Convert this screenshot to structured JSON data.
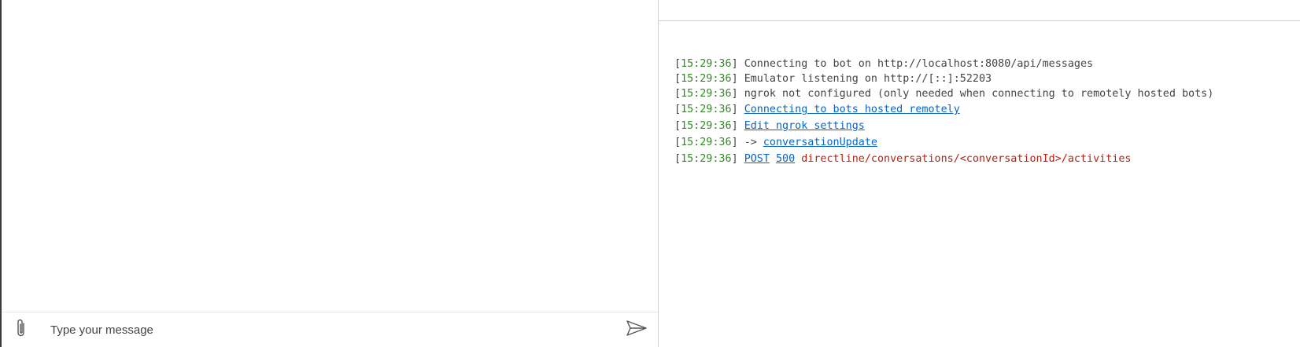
{
  "chat": {
    "input_placeholder": "Type your message",
    "input_value": ""
  },
  "icons": {
    "attach": "paperclip-icon",
    "send": "send-icon"
  },
  "colors": {
    "timestamp": "#2e8b20",
    "link": "#0a64c8",
    "error": "#b22312",
    "text": "#444444"
  },
  "log": {
    "entries": [
      {
        "timestamp": "15:29:36",
        "text": "Connecting to bot on http://localhost:8080/api/messages"
      },
      {
        "timestamp": "15:29:36",
        "text": "Emulator listening on http://[::]:52203"
      },
      {
        "timestamp": "15:29:36",
        "text": "ngrok not configured (only needed when connecting to remotely hosted bots)"
      },
      {
        "timestamp": "15:29:36",
        "link": "Connecting to bots hosted remotely"
      },
      {
        "timestamp": "15:29:36",
        "link": "Edit ngrok settings"
      },
      {
        "timestamp": "15:29:36",
        "prefix": "->",
        "link": "conversationUpdate"
      },
      {
        "timestamp": "15:29:36",
        "method": "POST",
        "status": "500",
        "path": "directline/conversations/<conversationId>/activities"
      }
    ]
  }
}
